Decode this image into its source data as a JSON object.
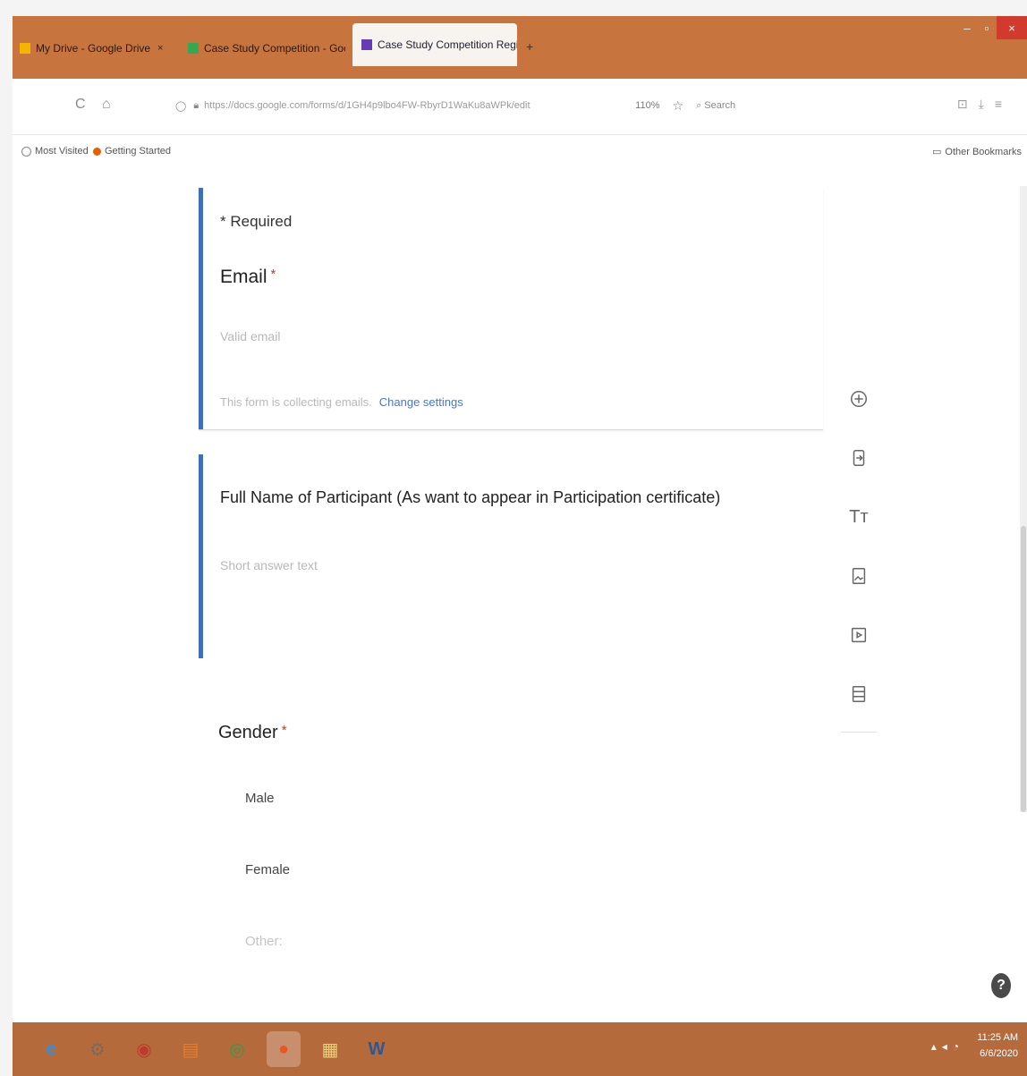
{
  "browser": {
    "tabs": [
      {
        "label": "My Drive - Google Drive",
        "close": "×",
        "favicon_color": "#f4b400"
      },
      {
        "label": "Case Study Competition - Goo",
        "close": "×",
        "favicon_color": "#34a853"
      },
      {
        "label": "Case Study Competition Regi",
        "close": "×",
        "favicon_color": "#673ab7"
      }
    ],
    "new_tab": "+",
    "window_controls": {
      "minimize": "–",
      "maximize": "▫",
      "close": "×"
    },
    "nav": {
      "back": "◯",
      "home": "⌂",
      "reload": "C"
    },
    "url": {
      "text": "https://docs.google.com/forms/d/1GH4p9lbo4FW-RbyrD1WaKu8aWPk/edit",
      "zoom": "110%",
      "search_label": "Search"
    },
    "bookmarks": [
      {
        "label": "Most Visited",
        "color": "#888888"
      },
      {
        "label": "Getting Started",
        "color": "#e66000"
      }
    ],
    "other_bookmarks": "Other Bookmarks"
  },
  "form": {
    "required_note": "* Required",
    "email": {
      "title": "Email",
      "star": "*",
      "placeholder": "Valid email",
      "collect_note": "This form is collecting emails.",
      "change_link": "Change settings"
    },
    "full_name": {
      "title": "Full Name of Participant (As want to appear in Participation certificate)",
      "placeholder": "Short answer text"
    },
    "gender": {
      "title": "Gender",
      "star": "*",
      "options": [
        "Male",
        "Female",
        "Other:"
      ]
    }
  },
  "toolbar": {
    "add_question": "add-question-icon",
    "import_questions": "import-questions-icon",
    "add_title": "Tт",
    "add_image": "add-image-icon",
    "add_video": "add-video-icon",
    "add_section": "add-section-icon"
  },
  "help": "?",
  "taskbar": {
    "time": "11:25 AM",
    "date": "6/6/2020",
    "apps": [
      {
        "label": "e",
        "color": "#2f8fe0"
      },
      {
        "label": "⚙",
        "color": "#7a6a5a"
      },
      {
        "label": "◉",
        "color": "#c0392b"
      },
      {
        "label": "▤",
        "color": "#e67e22"
      },
      {
        "label": "◎",
        "color": "#2e9e4f"
      },
      {
        "label": "●",
        "color": "#e8571d"
      },
      {
        "label": "▦",
        "color": "#e9d37a"
      },
      {
        "label": "W",
        "color": "#2b5797"
      }
    ]
  }
}
